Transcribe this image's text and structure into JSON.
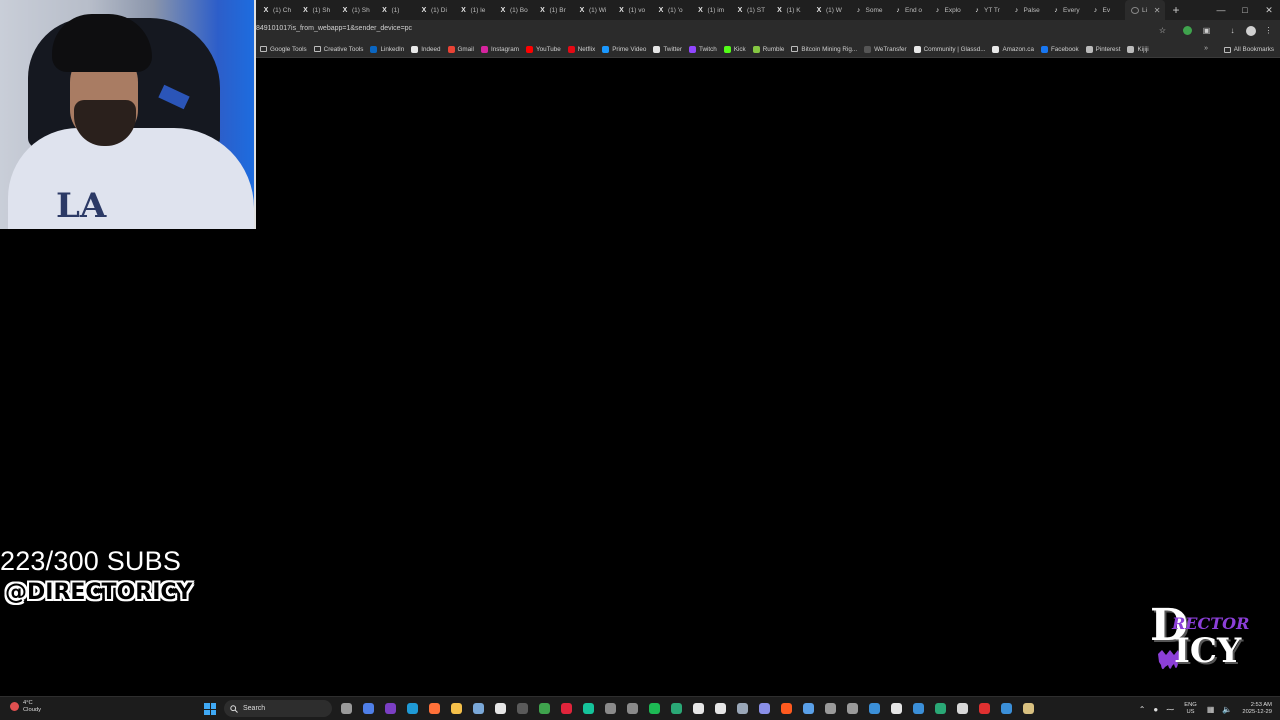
{
  "browser": {
    "tabs": [
      {
        "icon": "x-icon",
        "label": "(1) Ch"
      },
      {
        "icon": "x-icon",
        "label": "(1) Sh"
      },
      {
        "icon": "x-icon",
        "label": "(1) Sh"
      },
      {
        "icon": "x-icon",
        "label": "(1)"
      },
      {
        "icon": "x-icon",
        "label": "(1) Di"
      },
      {
        "icon": "x-icon",
        "label": "(1) le"
      },
      {
        "icon": "x-icon",
        "label": "(1) Bo"
      },
      {
        "icon": "x-icon",
        "label": "(1) Br"
      },
      {
        "icon": "x-icon",
        "label": "(1) Wi"
      },
      {
        "icon": "x-icon",
        "label": "(1) vo"
      },
      {
        "icon": "x-icon",
        "label": "(1) 'o"
      },
      {
        "icon": "x-icon",
        "label": "(1) im"
      },
      {
        "icon": "x-icon",
        "label": "(1) ST"
      },
      {
        "icon": "x-icon",
        "label": "(1) K"
      },
      {
        "icon": "x-icon",
        "label": "(1) W"
      },
      {
        "icon": "tiktok-icon",
        "label": "Some"
      },
      {
        "icon": "tiktok-icon",
        "label": "End o"
      },
      {
        "icon": "tiktok-icon",
        "label": "Explo"
      },
      {
        "icon": "tiktok-icon",
        "label": "YT Tr"
      },
      {
        "icon": "tiktok-icon",
        "label": "Palse"
      },
      {
        "icon": "tiktok-icon",
        "label": "Every"
      },
      {
        "icon": "tiktok-icon",
        "label": "Ev"
      },
      {
        "icon": "loading-icon",
        "label": "Li",
        "active": true
      }
    ],
    "url": "849101017is_from_webapp=1&sender_device=pc",
    "bookmarks": [
      {
        "icon": "folder",
        "label": "Google Tools",
        "color": "#bbbbbb"
      },
      {
        "icon": "folder",
        "label": "Creative Tools",
        "color": "#bbbbbb"
      },
      {
        "icon": "linkedin",
        "label": "LinkedIn",
        "color": "#0a66c2"
      },
      {
        "icon": "indeed",
        "label": "Indeed",
        "color": "#e8e8e8"
      },
      {
        "icon": "gmail",
        "label": "Gmail",
        "color": "#ea4335"
      },
      {
        "icon": "instagram",
        "label": "Instagram",
        "color": "#d6249f"
      },
      {
        "icon": "youtube",
        "label": "YouTube",
        "color": "#ff0000"
      },
      {
        "icon": "netflix",
        "label": "Netflix",
        "color": "#e50914"
      },
      {
        "icon": "prime-video",
        "label": "Prime Video",
        "color": "#1a98ff"
      },
      {
        "icon": "x",
        "label": "Twitter",
        "color": "#e6e6e6"
      },
      {
        "icon": "twitch",
        "label": "Twitch",
        "color": "#9146ff"
      },
      {
        "icon": "kick",
        "label": "Kick",
        "color": "#53fc18"
      },
      {
        "icon": "rumble",
        "label": "Rumble",
        "color": "#85c742"
      },
      {
        "icon": "folder",
        "label": "Bitcoin Mining Rig...",
        "color": "#bbbbbb"
      },
      {
        "icon": "wetransfer",
        "label": "WeTransfer",
        "color": "#555555"
      },
      {
        "icon": "glassdoor",
        "label": "Community | Glassd...",
        "color": "#e8e8e8"
      },
      {
        "icon": "amazon",
        "label": "Amazon.ca",
        "color": "#e8e8e8"
      },
      {
        "icon": "facebook",
        "label": "Facebook",
        "color": "#1877f2"
      },
      {
        "icon": "pinterest",
        "label": "Pinterest",
        "color": "#bbbbbb"
      },
      {
        "icon": "kijiji",
        "label": "Kijiji",
        "color": "#bbbbbb"
      }
    ],
    "bookmarks_more": "»",
    "all_bookmarks": "All Bookmarks"
  },
  "overlay": {
    "subs": "223/300 SUBS",
    "handle": "@DIRECTORICY",
    "logo_text": "DIRECTOR ICY"
  },
  "taskbar": {
    "weather_temp": "4°C",
    "weather_desc": "Cloudy",
    "search_placeholder": "Search",
    "apps": [
      {
        "name": "task-view",
        "color": "#9a9a9a"
      },
      {
        "name": "copilot",
        "color": "#4f7fe8"
      },
      {
        "name": "onenote",
        "color": "#7b3fc4"
      },
      {
        "name": "edge",
        "color": "#1f9ad6"
      },
      {
        "name": "firefox",
        "color": "#ff7139"
      },
      {
        "name": "file-explorer",
        "color": "#f5c04a"
      },
      {
        "name": "notepad",
        "color": "#7aa8d8"
      },
      {
        "name": "capcut",
        "color": "#e6e6e6"
      },
      {
        "name": "obs",
        "color": "#5a5a5a"
      },
      {
        "name": "chrome",
        "color": "#3fa34d"
      },
      {
        "name": "opera",
        "color": "#e0243b"
      },
      {
        "name": "grammarly",
        "color": "#15c39a"
      },
      {
        "name": "app-ring-1",
        "color": "#8a8a8a"
      },
      {
        "name": "app-ring-2",
        "color": "#8a8a8a"
      },
      {
        "name": "spotify",
        "color": "#1db954"
      },
      {
        "name": "app-green",
        "color": "#2aa876"
      },
      {
        "name": "capcut-2",
        "color": "#e6e6e6"
      },
      {
        "name": "medium",
        "color": "#e6e6e6"
      },
      {
        "name": "steam",
        "color": "#9aa7b8"
      },
      {
        "name": "discord",
        "color": "#8a8fe8"
      },
      {
        "name": "brave",
        "color": "#ff5a1f"
      },
      {
        "name": "app-arrow",
        "color": "#5aa0e8"
      },
      {
        "name": "app-clock",
        "color": "#9a9a9a"
      },
      {
        "name": "calculator",
        "color": "#9a9a9a"
      },
      {
        "name": "vs-code",
        "color": "#3b8fd8"
      },
      {
        "name": "x-app",
        "color": "#e6e6e6"
      },
      {
        "name": "app-blue",
        "color": "#3b8fd8"
      },
      {
        "name": "app-pen",
        "color": "#2aa876"
      },
      {
        "name": "app-feather",
        "color": "#d8d8d8"
      },
      {
        "name": "adobe",
        "color": "#e03030"
      },
      {
        "name": "app-arrow-2",
        "color": "#3b8fd8"
      },
      {
        "name": "microphone",
        "color": "#d8c080"
      }
    ],
    "lang_1": "ENG",
    "lang_2": "US",
    "time": "2:53 AM",
    "date": "2025-12-29"
  }
}
